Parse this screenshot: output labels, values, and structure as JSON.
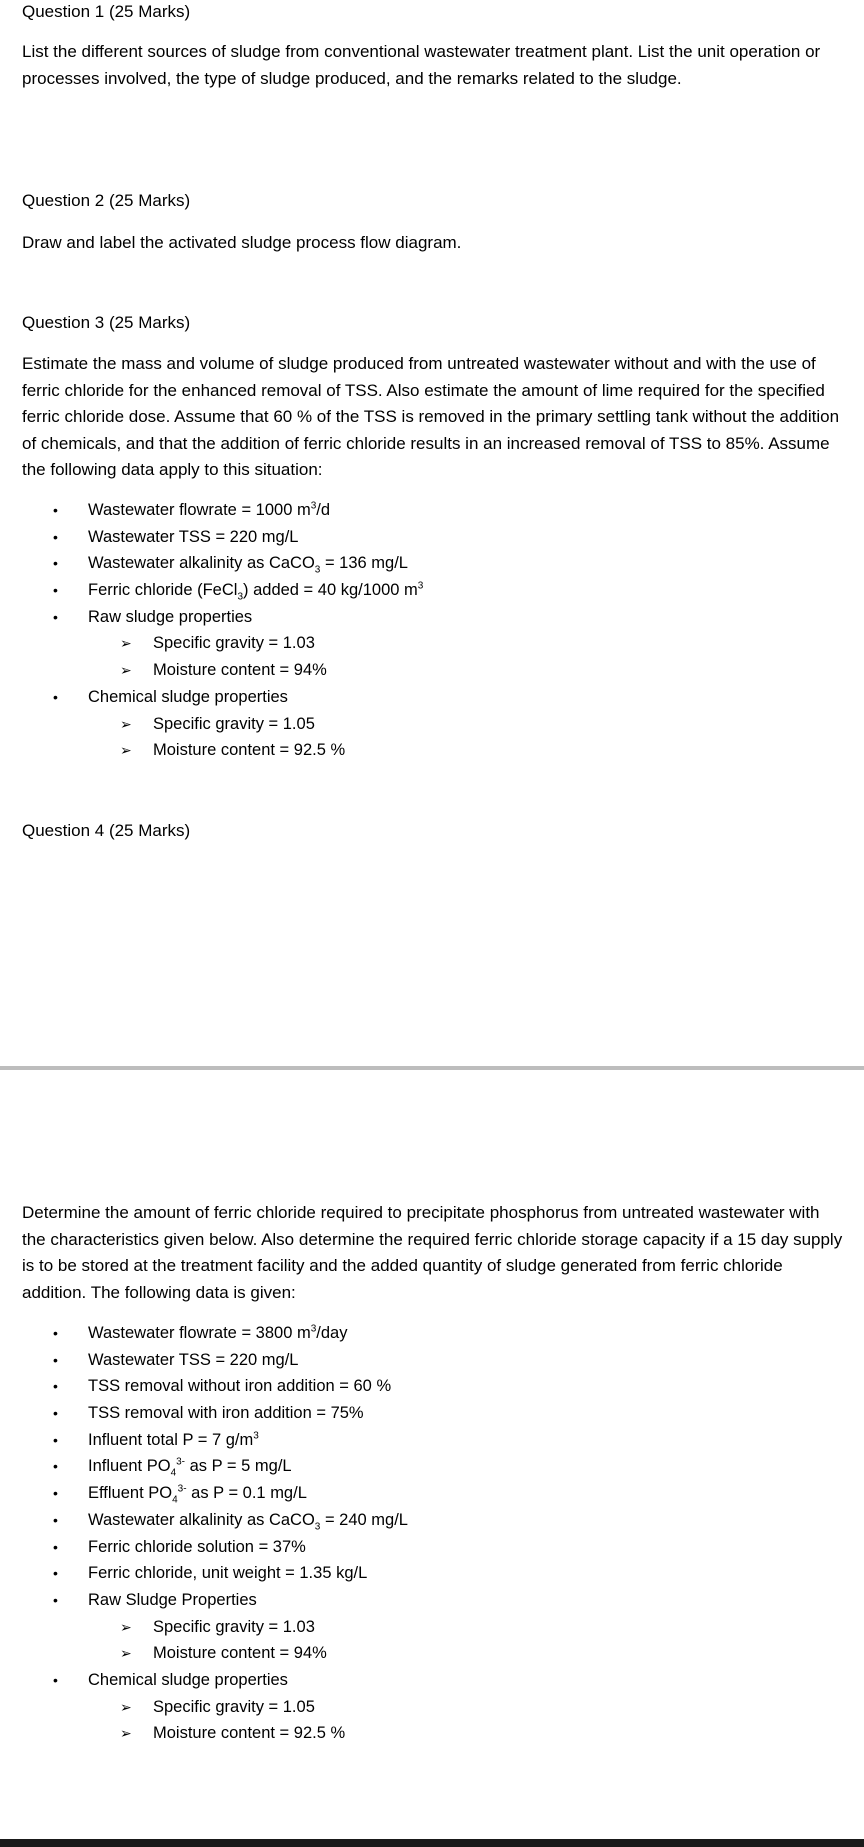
{
  "page1": {
    "q1": {
      "heading": "Question 1 (25 Marks)",
      "text": "List the different sources of sludge from conventional wastewater treatment plant. List the unit operation or processes involved, the type of sludge produced, and the remarks related to the sludge."
    },
    "q2": {
      "heading": "Question 2 (25 Marks)",
      "text": "Draw and label the activated sludge process flow diagram."
    },
    "q3": {
      "heading": "Question 3 (25 Marks)",
      "text": "Estimate the mass and volume of sludge produced from untreated wastewater without and with the use of ferric chloride for the enhanced removal of TSS. Also estimate the amount of lime required for the specified ferric chloride dose. Assume that 60 % of the TSS is removed in the primary settling tank without the addition of chemicals, and that the addition of ferric chloride results in an increased removal of TSS to 85%. Assume the following data apply to this situation:",
      "items": [
        {
          "level": 1,
          "pre": "Wastewater flowrate = 1000 m",
          "sup": "3",
          "post": "/d"
        },
        {
          "level": 1,
          "pre": "Wastewater TSS = 220 mg/L"
        },
        {
          "level": 1,
          "pre": "Wastewater alkalinity as CaCO",
          "sub": "3",
          "post": " = 136 mg/L"
        },
        {
          "level": 1,
          "pre": "Ferric chloride (FeCl",
          "sub": "3",
          "post": ") added = 40 kg/1000 m",
          "sup2": "3"
        },
        {
          "level": 1,
          "pre": "Raw sludge properties"
        },
        {
          "level": 2,
          "pre": "Specific gravity = 1.03"
        },
        {
          "level": 2,
          "pre": "Moisture content = 94%"
        },
        {
          "level": 1,
          "pre": "Chemical sludge properties"
        },
        {
          "level": 2,
          "pre": "Specific gravity = 1.05"
        },
        {
          "level": 2,
          "pre": "Moisture content = 92.5 %"
        }
      ]
    },
    "q4": {
      "heading": "Question 4 (25 Marks)"
    }
  },
  "page2": {
    "text": "Determine the amount of ferric chloride required to precipitate phosphorus from untreated wastewater with the characteristics given below. Also determine the required ferric chloride storage capacity if a 15 day supply is to be stored at the treatment facility and the added quantity of sludge generated from ferric chloride addition. The following data is given:",
    "items": [
      {
        "level": 1,
        "pre": "Wastewater flowrate = 3800 m",
        "sup": "3",
        "post": "/day"
      },
      {
        "level": 1,
        "pre": "Wastewater TSS = 220 mg/L"
      },
      {
        "level": 1,
        "pre": "TSS removal without iron addition = 60 %"
      },
      {
        "level": 1,
        "pre": "TSS removal with iron addition = 75%"
      },
      {
        "level": 1,
        "pre": "Influent total P = 7 g/m",
        "sup": "3"
      },
      {
        "level": 1,
        "pre": "Influent PO",
        "sub": "4",
        "sup": "3-",
        "post": " as P = 5 mg/L"
      },
      {
        "level": 1,
        "pre": "Effluent PO",
        "sub": "4",
        "sup": "3-",
        "post": " as P = 0.1 mg/L"
      },
      {
        "level": 1,
        "pre": "Wastewater alkalinity as CaCO",
        "sub": "3",
        "post": " = 240 mg/L"
      },
      {
        "level": 1,
        "pre": "Ferric chloride solution = 37%"
      },
      {
        "level": 1,
        "pre": "Ferric chloride, unit weight = 1.35 kg/L"
      },
      {
        "level": 1,
        "pre": "Raw Sludge Properties"
      },
      {
        "level": 2,
        "pre": "Specific gravity = 1.03"
      },
      {
        "level": 2,
        "pre": "Moisture content = 94%"
      },
      {
        "level": 1,
        "pre": "Chemical sludge properties"
      },
      {
        "level": 2,
        "pre": "Specific gravity = 1.05"
      },
      {
        "level": 2,
        "pre": "Moisture content = 92.5 %"
      }
    ]
  },
  "icons": {
    "bullet": "•",
    "arrow": "➢"
  }
}
